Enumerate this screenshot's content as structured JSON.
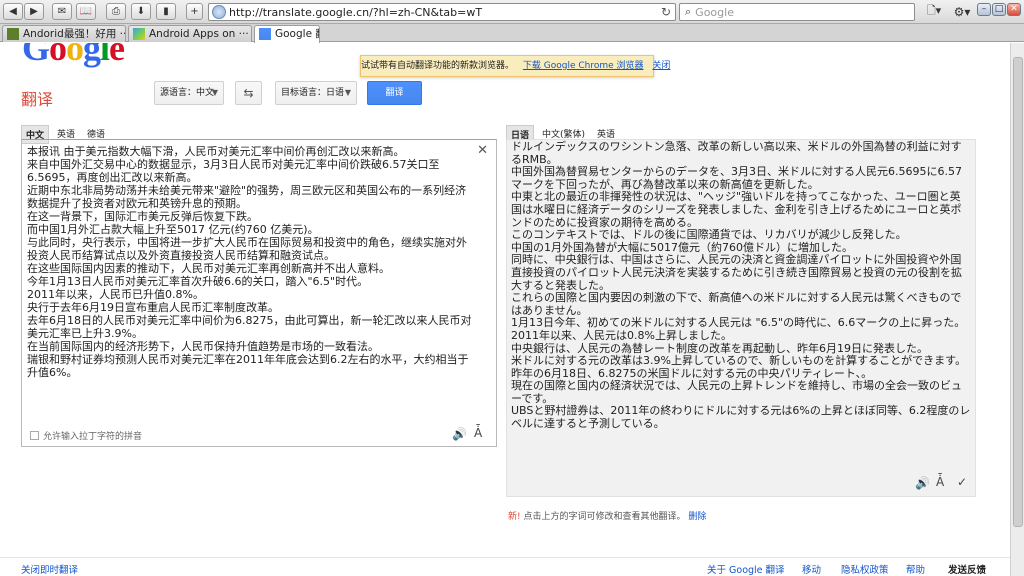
{
  "browser": {
    "url": "http://translate.google.cn/?hl=zh-CN&tab=wT",
    "search_placeholder": "Google",
    "tabs": [
      {
        "label": "Andorid最强！好用 ···"
      },
      {
        "label": "Android Apps on ···"
      },
      {
        "label": "Google 翻···"
      }
    ]
  },
  "header": {
    "logo": "Google",
    "product": "翻译",
    "promo_text": "试试带有自动翻译功能的新款浏览器。",
    "promo_link": "下载 Google Chrome 浏览器",
    "promo_close": "关闭",
    "source_lang": "源语言：中文",
    "target_lang": "目标语言：日语",
    "translate_button": "翻译"
  },
  "source": {
    "tabs": [
      "中文",
      "英语",
      "德语"
    ],
    "text": "本报讯 由于美元指数大幅下滑，人民币对美元汇率中间价再创汇改以来新高。\n来自中国外汇交易中心的数据显示，3月3日人民币对美元汇率中间价跌破6.57关口至6.5695，再度创出汇改以来新高。\n近期中东北非局势动荡并未给美元带来\"避险\"的强势，周三欧元区和英国公布的一系列经济数据提升了投资者对欧元和英镑升息的预期。\n在这一背景下，国际汇市美元反弹后恢复下跌。\n而中国1月外汇占款大幅上升至5017 亿元(约760 亿美元)。\n与此同时，央行表示，中国将进一步扩大人民币在国际贸易和投资中的角色，继续实施对外投资人民币结算试点以及外资直接投资人民币结算和融资试点。\n在这些国际国内因素的推动下，人民币对美元汇率再创新高并不出人意料。\n今年1月13日人民币对美元汇率首次升破6.6的关口，踏入\"6.5\"时代。\n2011年以来，人民币已升值0.8%。\n央行于去年6月19日宣布重启人民币汇率制度改革。\n去年6月18日的人民币对美元汇率中间价为6.8275，由此可算出，新一轮汇改以来人民币对美元汇率已上升3.9%。\n在当前国际国内的经济形势下，人民币保持升值趋势是市场的一致看法。\n瑞银和野村证券均预测人民币对美元汇率在2011年年底会达到6.2左右的水平，大约相当于升值6%。",
    "pinyin_label": "允许输入拉丁字符的拼音"
  },
  "result": {
    "tabs": [
      "日语",
      "中文(繁体)",
      "英语"
    ],
    "text": "ドルインデックスのワシントン急落、改革の新しい高以来、米ドルの外国為替の利益に対するRMB。\n中国外国為替貿易センターからのデータを、3月3日、米ドルに対する人民元6.5695に6.57マークを下回ったが、再び為替改革以来の新高値を更新した。\n中東と北の最近の非揮発性の状況は、\"ヘッジ\"強いドルを持ってこなかった、ユーロ圏と英国は水曜日に経済データのシリーズを発表しました、金利を引き上げるためにユーロと英ポンドのために投資家の期待を高める。\nこのコンテキストでは、ドルの後に国際通貨では、リカバリが減少し反発した。\n中国の1月外国為替が大幅に5017億元（約760億ドル）に増加した。\n同時に、中央銀行は、中国はさらに、人民元の決済と資金調達パイロットに外国投資や外国直接投資のパイロット人民元決済を実装するために引き続き国際貿易と投資の元の役割を拡大すると発表した。\nこれらの国際と国内要因の刺激の下で、新高値への米ドルに対する人民元は驚くべきものではありません。\n1月13日今年、初めての米ドルに対する人民元は \"6.5\"の時代に、6.6マークの上に昇った。\n2011年以来、人民元は0.8%上昇しました。\n中央銀行は、人民元の為替レート制度の改革を再起動し、昨年6月19日に発表した。\n米ドルに対する元の改革は3.9%上昇しているので、新しいものを計算することができます。昨年の6月18日、6.8275の米国ドルに対する元の中央パリティレート、。\n現在の国際と国内の経済状況では、人民元の上昇トレンドを維持し、市場の全会一致のビューです。\nUBSと野村證券は、2011年の終わりにドルに対する元は6%の上昇とほぼ同等、6.2程度のレベルに達すると予測している。",
    "hint_new": "新!",
    "hint_text": "点击上方的字词可修改和查看其他翻译。",
    "hint_dismiss": "删除"
  },
  "footer": {
    "left": "关闭即时翻译",
    "links": [
      "关于 Google 翻译",
      "移动",
      "隐私权政策",
      "帮助",
      "发送反馈"
    ]
  },
  "icons": {
    "speaker": "speaker-icon",
    "text_style": "text-style-icon",
    "check": "check-icon"
  }
}
